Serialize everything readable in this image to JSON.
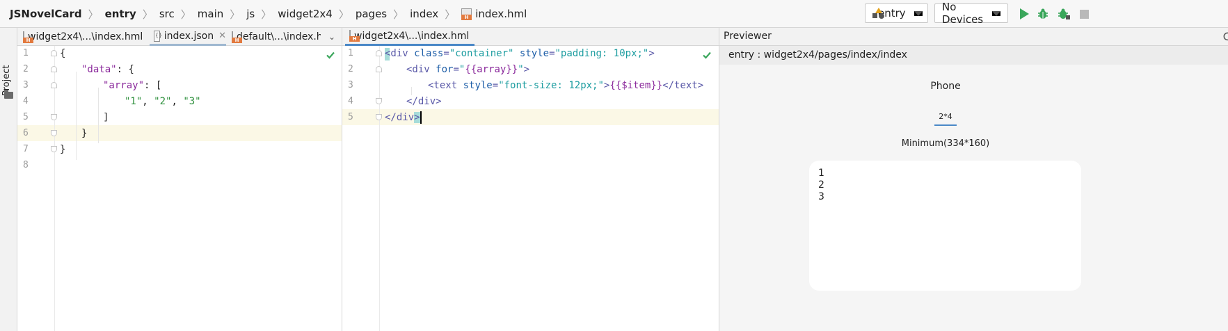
{
  "breadcrumb": [
    "JSNovelCard",
    "entry",
    "src",
    "main",
    "js",
    "widget2x4",
    "pages",
    "index",
    "index.hml"
  ],
  "toolbar": {
    "module_combo": "entry",
    "device_combo": "No Devices",
    "run_color": "#3aa65b",
    "debug_color": "#3aa65b"
  },
  "toolstrip": {
    "project_label": "Project"
  },
  "left_editor": {
    "tabs": [
      {
        "label": "widget2x4\\...\\index.hml",
        "icon": "hml-file-icon"
      },
      {
        "label": "index.json",
        "icon": "json-file-icon"
      },
      {
        "label": "default\\...\\index.hml",
        "icon": "hml-file-icon"
      }
    ],
    "line_numbers": [
      "1",
      "2",
      "3",
      "4",
      "5",
      "6",
      "7",
      "8"
    ],
    "code": {
      "l1": "{",
      "l2_key": "\"data\"",
      "l2_rest": ": {",
      "l3_key": "\"array\"",
      "l3_rest": ": [",
      "l4_s1": "\"1\"",
      "l4_c1": ", ",
      "l4_s2": "\"2\"",
      "l4_c2": ", ",
      "l4_s3": "\"3\"",
      "l5": "]",
      "l6": "}",
      "l7": "}"
    }
  },
  "right_editor": {
    "tabs": [
      {
        "label": "widget2x4\\...\\index.hml",
        "icon": "hml-file-icon"
      }
    ],
    "line_numbers": [
      "1",
      "2",
      "3",
      "4",
      "5"
    ],
    "code": {
      "l1_open": "<div",
      "l1_a1": "class",
      "l1_eq1": "=",
      "l1_v1": "\"container\"",
      "l1_a2": "style",
      "l1_eq2": "=",
      "l1_v2": "\"padding: 10px;\"",
      "l1_close": ">",
      "l2_open": "<div",
      "l2_a1": "for",
      "l2_eq1": "=",
      "l2_q1": "\"",
      "l2_expr": "{{array}}",
      "l2_q2": "\"",
      "l2_close": ">",
      "l3_open": "<text",
      "l3_a1": "style",
      "l3_eq1": "=",
      "l3_v1": "\"font-size: 12px;\"",
      "l3_close": ">",
      "l3_expr": "{{$item}}",
      "l3_end": "</text>",
      "l4": "</div>",
      "l5_a": "</div",
      "l5_b": ">"
    }
  },
  "previewer": {
    "title": "Previewer",
    "path": "entry : widget2x4/pages/index/index",
    "device": "Phone",
    "size_tab": "2*4",
    "minimum": "Minimum(334*160)",
    "items": [
      "1",
      "2",
      "3"
    ]
  }
}
